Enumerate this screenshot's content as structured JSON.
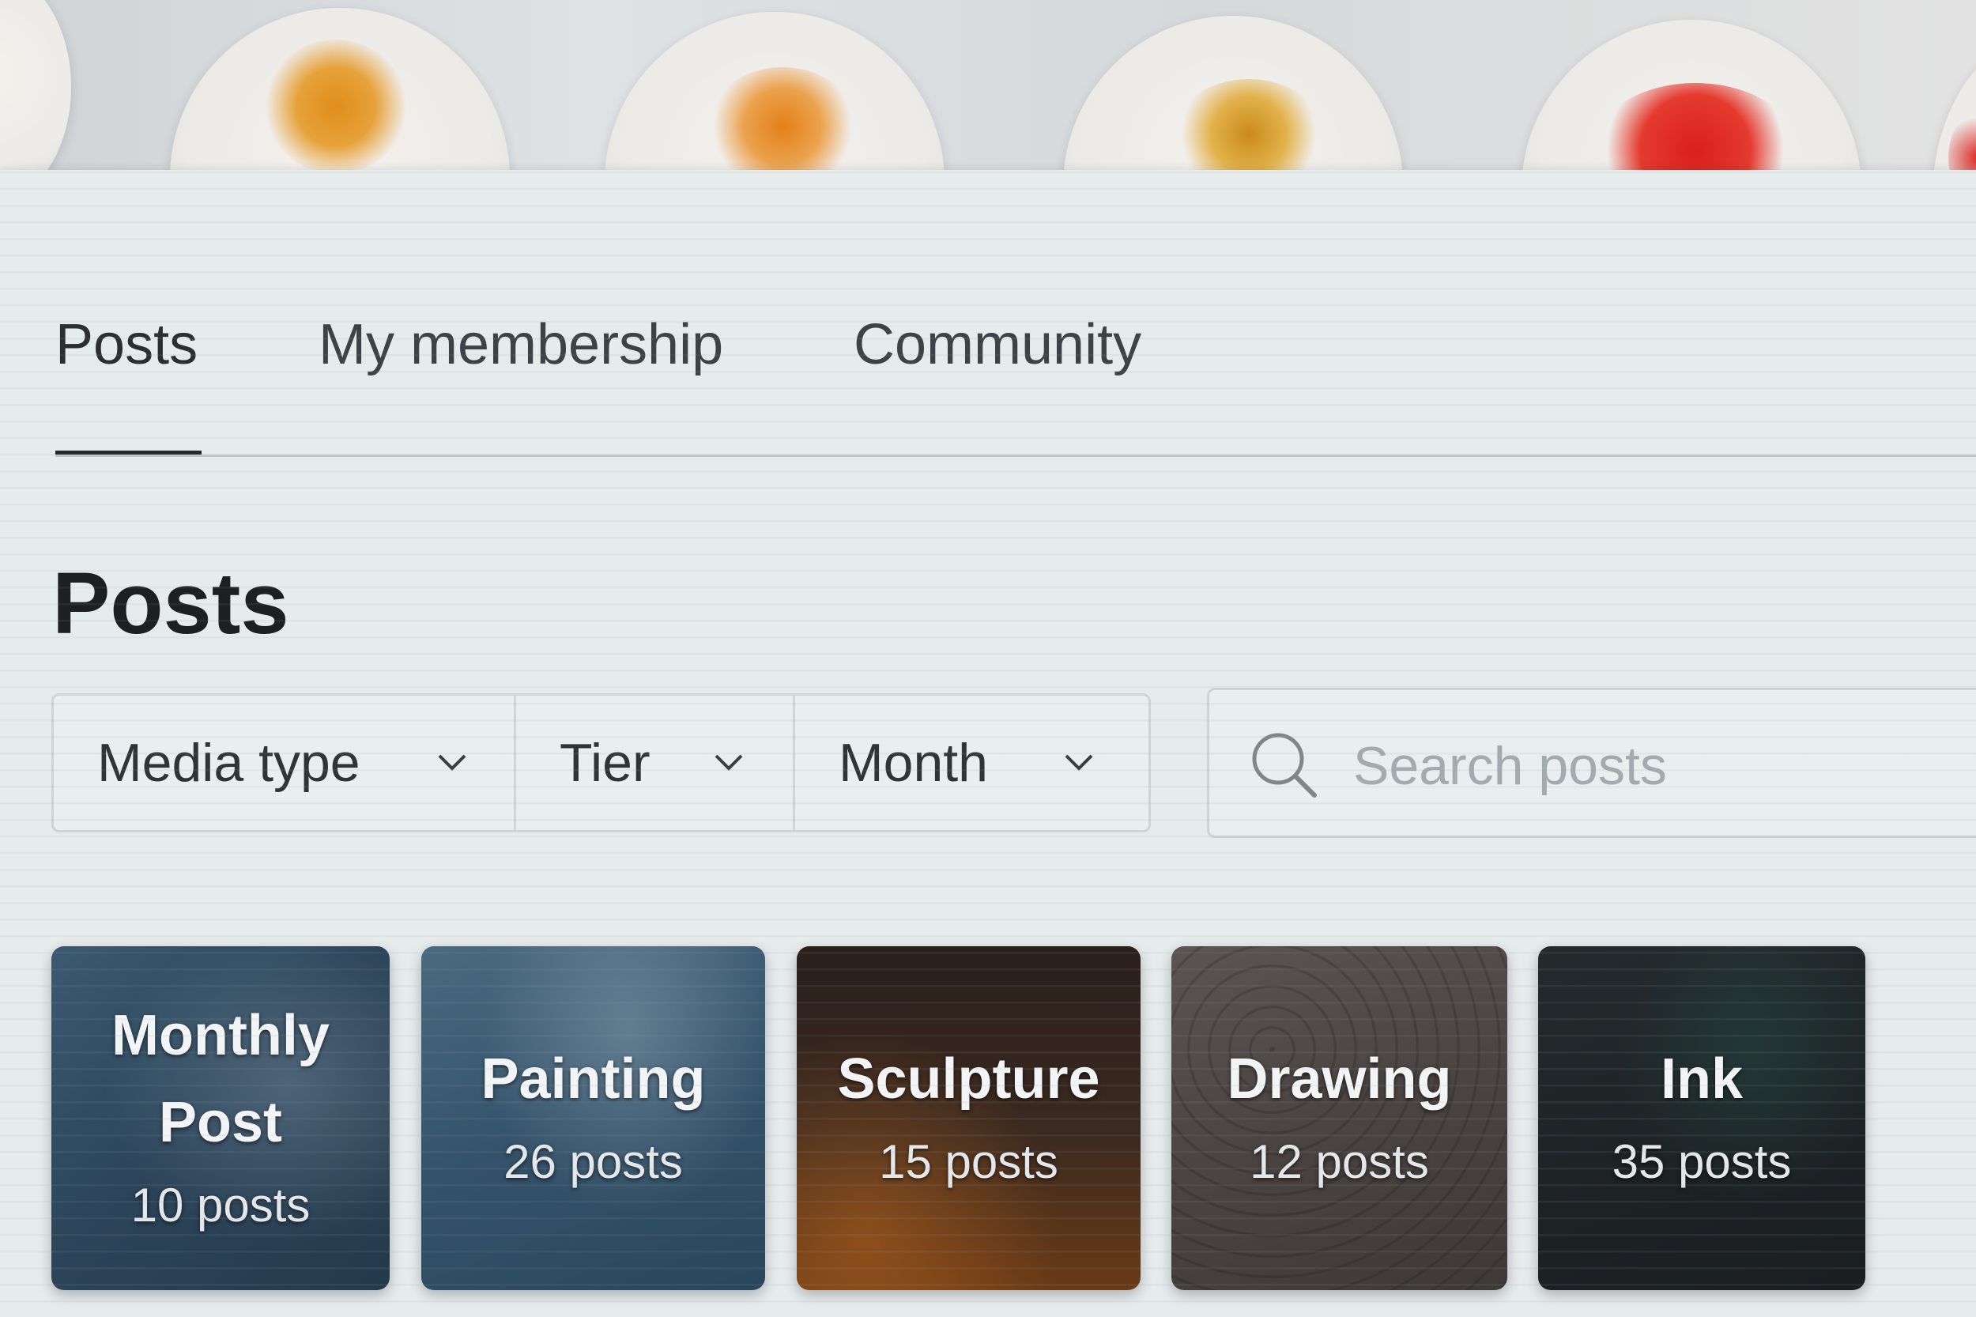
{
  "tabs": [
    {
      "label": "Posts"
    },
    {
      "label": "My membership"
    },
    {
      "label": "Community"
    }
  ],
  "page_title": "Posts",
  "filters": [
    {
      "label": "Media type",
      "icon": "chevron-down-icon"
    },
    {
      "label": "Tier",
      "icon": "chevron-down-icon"
    },
    {
      "label": "Month",
      "icon": "chevron-down-icon"
    }
  ],
  "search": {
    "placeholder": "Search posts",
    "icon": "search-icon"
  },
  "categories": [
    {
      "title_line1": "Monthly",
      "title_line2": "Post",
      "count": "10 posts",
      "color": "#2f4a5f"
    },
    {
      "title": "Painting",
      "count": "26 posts",
      "color": "#38586e"
    },
    {
      "title": "Sculpture",
      "count": "15 posts",
      "color": "#2a1e1a"
    },
    {
      "title": "Drawing",
      "count": "12 posts",
      "color": "#4a4442"
    },
    {
      "title": "Ink",
      "count": "35 posts",
      "color": "#1f2427"
    }
  ],
  "banner_artworks": [
    "orange ink splash",
    "orange ink splash",
    "yellow floral ink",
    "red ink splash"
  ]
}
